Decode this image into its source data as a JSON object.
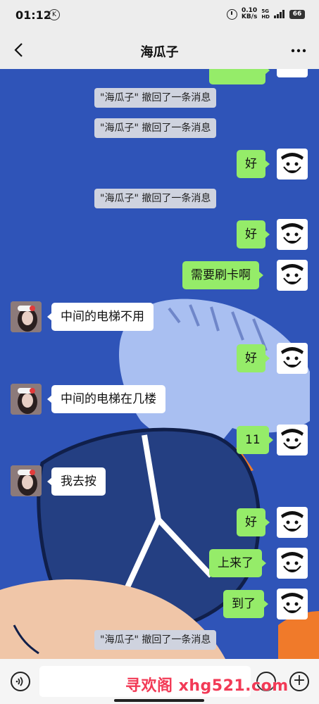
{
  "status": {
    "time": "01:12",
    "k_badge": "K",
    "speed_value": "0.10",
    "speed_unit": "KB/s",
    "net1": "5G",
    "net2": "HD",
    "battery": "66"
  },
  "nav": {
    "title": "海瓜子",
    "back_icon": "chevron-left-icon",
    "more_icon": "more-icon"
  },
  "colors": {
    "chat_bg": "#2f54b8",
    "bubble_self": "#95ec69",
    "bubble_other": "#ffffff",
    "recall_bg": "#cfd3df",
    "watermark": "#f23a56"
  },
  "messages": [
    {
      "type": "recall",
      "text": "\"海瓜子\" 撤回了一条消息"
    },
    {
      "type": "recall",
      "text": "\"海瓜子\" 撤回了一条消息"
    },
    {
      "type": "self",
      "text": "好"
    },
    {
      "type": "recall",
      "text": "\"海瓜子\" 撤回了一条消息"
    },
    {
      "type": "self",
      "text": "好"
    },
    {
      "type": "self",
      "text": "需要刷卡啊"
    },
    {
      "type": "other",
      "text": "中间的电梯不用"
    },
    {
      "type": "self",
      "text": "好"
    },
    {
      "type": "other",
      "text": "中间的电梯在几楼"
    },
    {
      "type": "self",
      "text": "11"
    },
    {
      "type": "other",
      "text": "我去按"
    },
    {
      "type": "self",
      "text": "好"
    },
    {
      "type": "self",
      "text": "上来了"
    },
    {
      "type": "self",
      "text": "到了"
    },
    {
      "type": "recall",
      "text": "\"海瓜子\" 撤回了一条消息"
    }
  ],
  "input": {
    "voice_icon": "voice-icon",
    "emoji_icon": "emoji-icon",
    "plus_icon": "plus-icon",
    "value": ""
  },
  "watermark": "寻欢阁 xhg521.com"
}
